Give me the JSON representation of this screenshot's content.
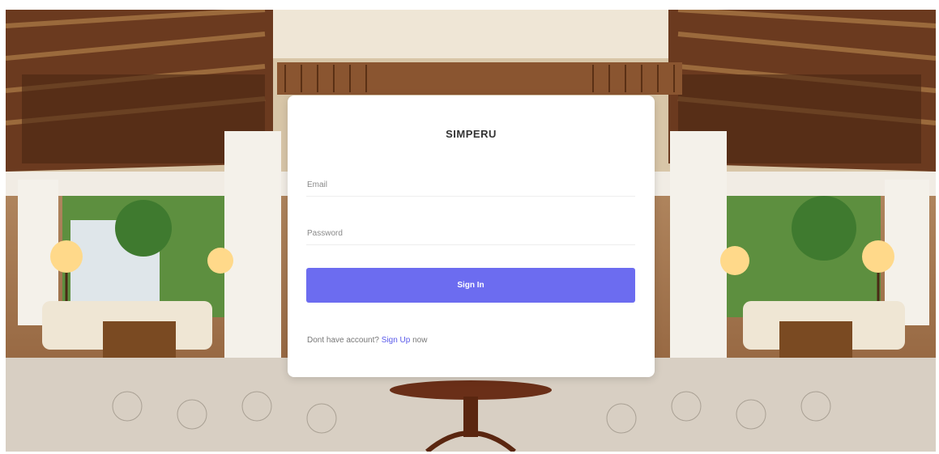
{
  "background": {
    "description_icon": "hotel-lobby-photo"
  },
  "login": {
    "title": "SIMPERU",
    "email_placeholder": "Email",
    "password_placeholder": "Password",
    "signin_label": "Sign In",
    "signup_prefix": "Dont have account?",
    "signup_link": "Sign Up",
    "signup_suffix": "now"
  },
  "colors": {
    "primary": "#6c6cf0",
    "link": "#5b5bea"
  }
}
